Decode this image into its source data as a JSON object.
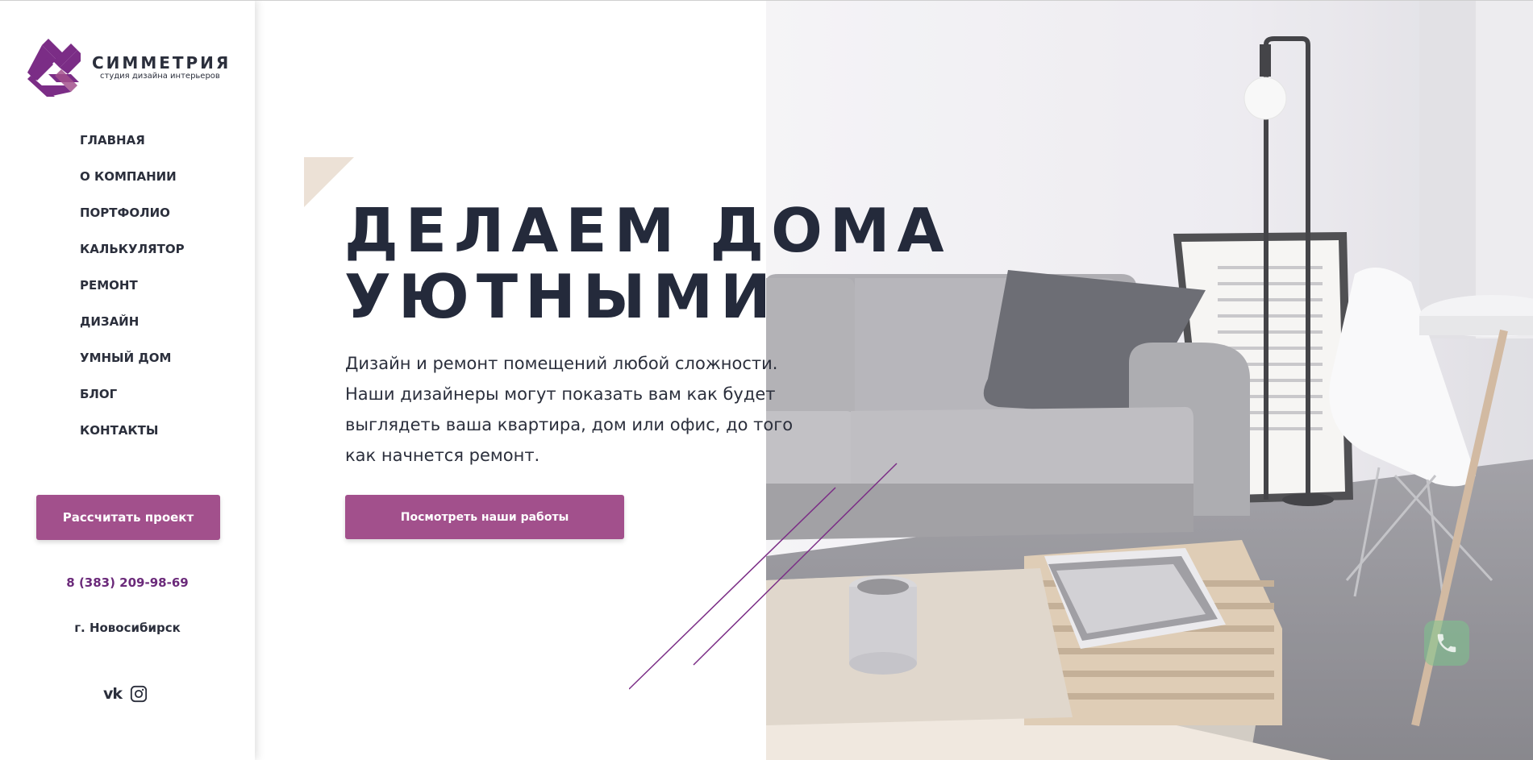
{
  "brand": {
    "name": "СИММЕТРИЯ",
    "tagline": "студия дизайна интерьеров",
    "color": "#7b2d86"
  },
  "nav": {
    "items": [
      {
        "label": "ГЛАВНАЯ"
      },
      {
        "label": "О КОМПАНИИ"
      },
      {
        "label": "ПОРТФОЛИО"
      },
      {
        "label": "КАЛЬКУЛЯТОР"
      },
      {
        "label": "РЕМОНТ"
      },
      {
        "label": "ДИЗАЙН"
      },
      {
        "label": "УМНЫЙ ДОМ"
      },
      {
        "label": "БЛОГ"
      },
      {
        "label": "КОНТАКТЫ"
      }
    ]
  },
  "sidebar": {
    "cta_label": "Рассчитать проект",
    "phone": "8 (383) 209-98-69",
    "city": "г. Новосибирск",
    "socials": [
      "vk-icon",
      "instagram-icon"
    ]
  },
  "hero": {
    "title_line1": "ДЕЛАЕМ ДОМА",
    "title_line2": "УЮТНЫМИ",
    "text_lines": [
      "Дизайн и ремонт помещений любой сложности.",
      "Наши дизайнеры могут показать вам как будет",
      "выглядеть ваша квартира, дом или офис, до того",
      "как начнется ремонт."
    ],
    "cta_label": "Посмотреть наши работы"
  },
  "colors": {
    "accent": "#a2508c",
    "text_dark": "#242a3b",
    "deco_beige": "#ece1d6",
    "call_button": "#7cc48c"
  }
}
